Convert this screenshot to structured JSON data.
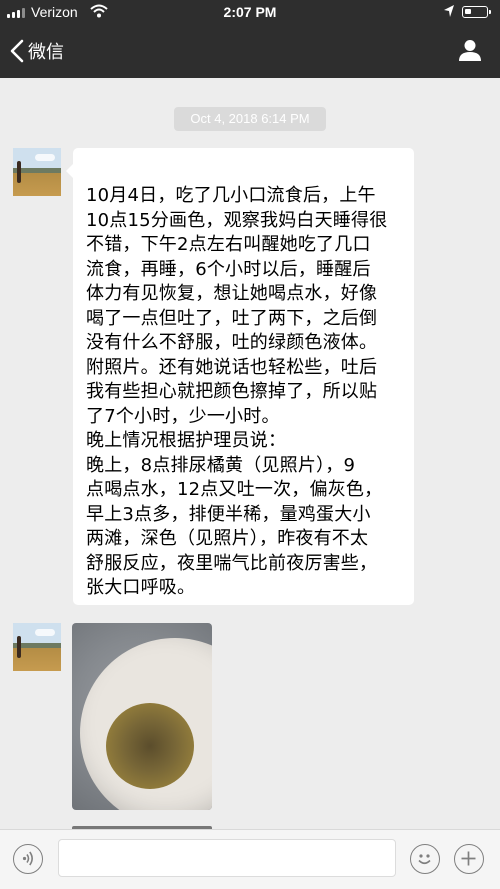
{
  "status_bar": {
    "carrier": "Verizon",
    "time": "2:07 PM"
  },
  "nav": {
    "back_label": "微信"
  },
  "chat": {
    "timestamp": "Oct 4, 2018 6:14 PM",
    "message_text": "10月4日，吃了几小口流食后，上午\n10点15分画色，观察我妈白天睡得很\n不错，下午2点左右叫醒她吃了几口\n流食，再睡，6个小时以后，睡醒后\n体力有见恢复，想让她喝点水，好像\n喝了一点但吐了，吐了两下，之后倒\n没有什么不舒服，吐的绿颜色液体。\n附照片。还有她说话也轻松些，吐后\n我有些担心就把颜色擦掉了，所以贴\n了7个小时，少一小时。\n晚上情况根据护理员说：\n晚上，8点排尿橘黄（见照片），9\n点喝点水，12点又吐一次，偏灰色，\n早上3点多，排便半稀，量鸡蛋大小\n两滩，深色（见照片），昨夜有不太\n舒服反应，夜里喘气比前夜厉害些，\n张大口呼吸。"
  },
  "input_bar": {
    "text_value": ""
  },
  "icons": [
    "signal-icon",
    "wifi-icon",
    "location-arrow-icon",
    "battery-icon",
    "back-chevron-icon",
    "profile-icon",
    "voice-icon",
    "emoji-icon",
    "plus-icon"
  ],
  "colors": {
    "top_bar": "#2e2e2e",
    "chat_background": "#ededed",
    "bubble": "#ffffff",
    "timestamp_pill": "#dadada"
  }
}
